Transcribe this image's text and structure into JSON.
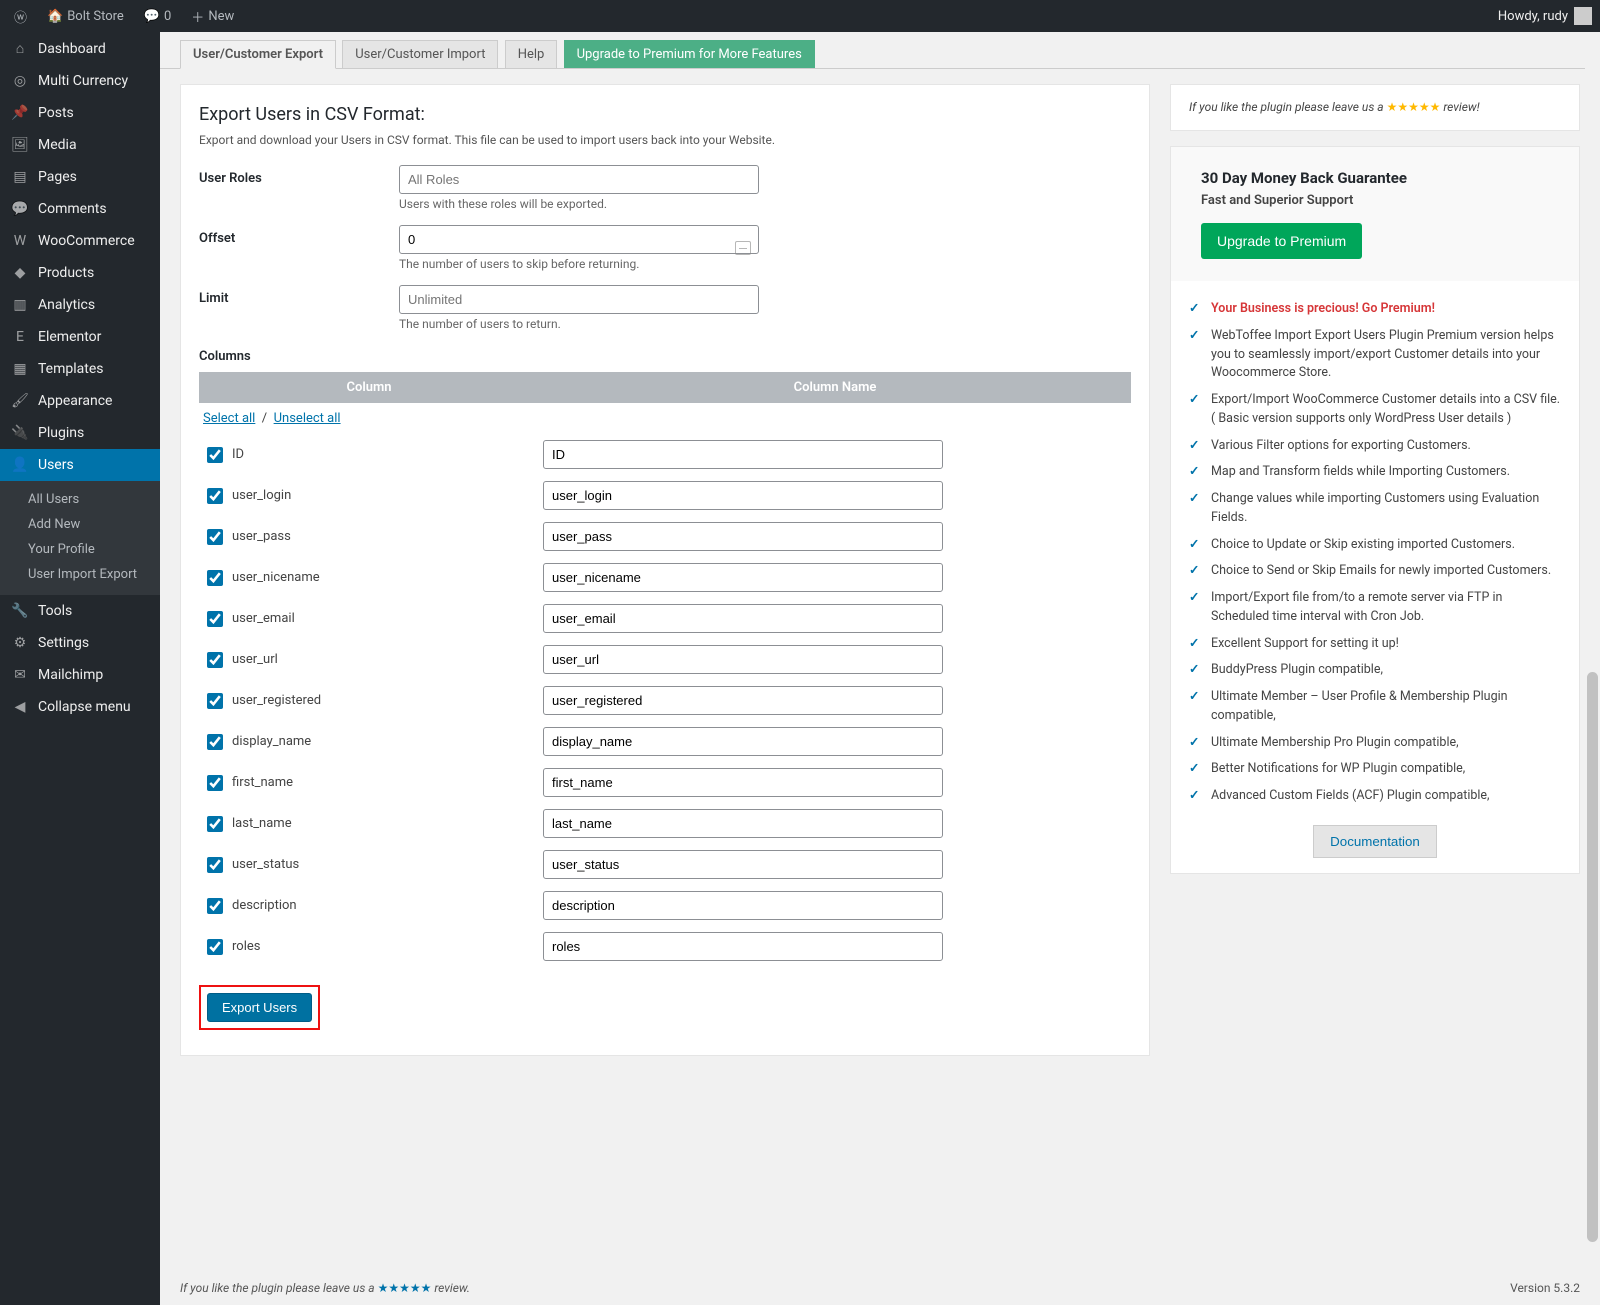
{
  "adminbar": {
    "site": "Bolt Store",
    "comments": "0",
    "new": "New",
    "howdy": "Howdy, rudy"
  },
  "sidebar": {
    "dashboard": "Dashboard",
    "multicurrency": "Multi Currency",
    "posts": "Posts",
    "media": "Media",
    "pages": "Pages",
    "comments": "Comments",
    "woocommerce": "WooCommerce",
    "products": "Products",
    "analytics": "Analytics",
    "elementor": "Elementor",
    "templates": "Templates",
    "appearance": "Appearance",
    "plugins": "Plugins",
    "users": "Users",
    "tools": "Tools",
    "settings": "Settings",
    "mailchimp": "Mailchimp",
    "collapse": "Collapse menu"
  },
  "users_submenu": {
    "all": "All Users",
    "add": "Add New",
    "profile": "Your Profile",
    "import_export": "User Import Export"
  },
  "tabs": {
    "export": "User/Customer Export",
    "import": "User/Customer Import",
    "help": "Help",
    "upgrade": "Upgrade to Premium for More Features"
  },
  "page": {
    "title": "Export Users in CSV Format:",
    "desc": "Export and download your Users in CSV format. This file can be used to import users back into your Website.",
    "roles_label": "User Roles",
    "roles_placeholder": "All Roles",
    "roles_help": "Users with these roles will be exported.",
    "offset_label": "Offset",
    "offset_value": "0",
    "offset_help": "The number of users to skip before returning.",
    "limit_label": "Limit",
    "limit_placeholder": "Unlimited",
    "limit_help": "The number of users to return.",
    "columns_label": "Columns",
    "col_h1": "Column",
    "col_h2": "Column Name",
    "select_all": "Select all",
    "unselect_all": "Unselect all",
    "export_btn": "Export Users"
  },
  "columns": [
    {
      "key": "ID",
      "name": "ID"
    },
    {
      "key": "user_login",
      "name": "user_login"
    },
    {
      "key": "user_pass",
      "name": "user_pass"
    },
    {
      "key": "user_nicename",
      "name": "user_nicename"
    },
    {
      "key": "user_email",
      "name": "user_email"
    },
    {
      "key": "user_url",
      "name": "user_url"
    },
    {
      "key": "user_registered",
      "name": "user_registered"
    },
    {
      "key": "display_name",
      "name": "display_name"
    },
    {
      "key": "first_name",
      "name": "first_name"
    },
    {
      "key": "last_name",
      "name": "last_name"
    },
    {
      "key": "user_status",
      "name": "user_status"
    },
    {
      "key": "description",
      "name": "description"
    },
    {
      "key": "roles",
      "name": "roles"
    }
  ],
  "review": {
    "prefix": "If you like the plugin please leave us a ",
    "stars": "★★★★★",
    "suffix": " review!"
  },
  "premium_box": {
    "guarantee": "30 Day Money Back Guarantee",
    "support": "Fast and Superior Support",
    "upgrade_btn": "Upgrade to Premium"
  },
  "premium_features": [
    "Your Business is precious! Go Premium!",
    "WebToffee Import Export Users Plugin Premium version helps you to seamlessly import/export Customer details into your Woocommerce Store.",
    "Export/Import WooCommerce Customer details into a CSV file.( Basic version supports only WordPress User details )",
    "Various Filter options for exporting Customers.",
    "Map and Transform fields while Importing Customers.",
    "Change values while importing Customers using Evaluation Fields.",
    "Choice to Update or Skip existing imported Customers.",
    "Choice to Send or Skip Emails for newly imported Customers.",
    "Import/Export file from/to a remote server via FTP in Scheduled time interval with Cron Job.",
    "Excellent Support for setting it up!",
    "BuddyPress Plugin compatible,",
    "Ultimate Member – User Profile & Membership Plugin compatible,",
    "Ultimate Membership Pro Plugin compatible,",
    "Better Notifications for WP Plugin compatible,",
    "Advanced Custom Fields (ACF) Plugin compatible,"
  ],
  "documentation_btn": "Documentation",
  "footer": {
    "review": "If you like the plugin please leave us a ",
    "stars": "★★★★★",
    "suffix": " review.",
    "version": "Version 5.3.2"
  }
}
